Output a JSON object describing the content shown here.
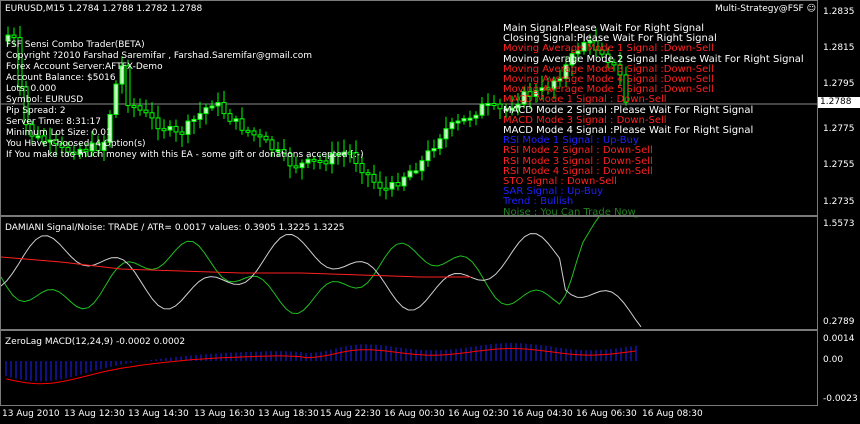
{
  "header": {
    "symbol_title": "EURUSD,M15  1.2784 1.2788 1.2782 1.2788",
    "ea_name": "Multi-Strategy@FSF"
  },
  "ea_info": [
    "FSF Sensi Combo Trader(BETA)",
    "Copyright ?2010 Farshad Saremifar , Farshad.Saremifar@gmail.com",
    "Forex Account Server:AFTFX-Demo",
    "Account Balance:  $5016",
    "Lots:  0.000",
    "Symbol: EURUSD",
    "Pip Spread:  2",
    " Server Time: 8:31:17",
    "Minimum Lot Size: 0.01",
    "You Have Choosed: 4 Option(s)",
    "If You make too much money with this EA - some gift or donations accepted [:-)"
  ],
  "signals": [
    {
      "text": "Main Signal:Please Wait For Right Signal",
      "color": "#ffffff"
    },
    {
      "text": "Closing Signal:Please Wait For Right Signal",
      "color": "#ffffff"
    },
    {
      "text": "Moving Average Mode 1 Signal :Down-Sell",
      "color": "#ff2020"
    },
    {
      "text": "Moving Average Mode 2 Signal :Please Wait For Right Signal",
      "color": "#ffffff"
    },
    {
      "text": "Moving Average Mode 3 Signal :Down-Sell",
      "color": "#ff2020"
    },
    {
      "text": "Moving Average Mode 4 Signal :Down-Sell",
      "color": "#ff2020"
    },
    {
      "text": "Moving Average Mode 5 Signal :Down-Sell",
      "color": "#ff2020"
    },
    {
      "text": "MACD Mode 1 Signal : Down-Sell",
      "color": "#ff2020"
    },
    {
      "text": "MACD Mode 2 Signal :Please Wait For Right Signal",
      "color": "#ffffff"
    },
    {
      "text": "MACD Mode 3 Signal : Down-Sell",
      "color": "#ff2020"
    },
    {
      "text": "MACD Mode 4 Signal :Please Wait For Right Signal",
      "color": "#ffffff"
    },
    {
      "text": "RSI Mode 1 Signal : Up-Buy",
      "color": "#2020ff"
    },
    {
      "text": "RSI Mode 2 Signal : Down-Sell",
      "color": "#ff2020"
    },
    {
      "text": "RSI Mode 3 Signal : Down-Sell",
      "color": "#ff2020"
    },
    {
      "text": "RSI Mode 4 Signal : Down-Sell",
      "color": "#ff2020"
    },
    {
      "text": "STO Signal : Down-Sell",
      "color": "#ff2020"
    },
    {
      "text": "SAR Signal : Up-Buy",
      "color": "#2020ff"
    },
    {
      "text": "Trend : Bullish",
      "color": "#2020ff"
    },
    {
      "text": "Noise : You Can Trade Now",
      "color": "#208020"
    }
  ],
  "price_axis": {
    "labels": [
      "1.2835",
      "1.2815",
      "1.2795",
      "1.2775",
      "1.2755",
      "1.2735"
    ],
    "current": "1.2788"
  },
  "damiani": {
    "title": "DAMIANI Signal/Noise: TRADE  / ATR= 0.0017     values: 0.3905 1.3225 1.3225",
    "axis_top": "1.5573",
    "axis_bottom": "0.2789"
  },
  "macd": {
    "title": "ZeroLag MACD(12,24,9) -0.0002 0.0002",
    "axis_top": "0.0014",
    "axis_mid": "0.00",
    "axis_bottom": "-0.0023"
  },
  "time_axis": [
    "13 Aug 2010",
    "13 Aug 12:30",
    "13 Aug 14:30",
    "13 Aug 16:30",
    "13 Aug 18:30",
    "15 Aug 22:30",
    "16 Aug 00:30",
    "16 Aug 02:30",
    "16 Aug 04:30",
    "16 Aug 06:30",
    "16 Aug 08:30"
  ],
  "colors": {
    "bull_candle": "#ccffcc",
    "candle_wick": "#00ff00",
    "damiani_green": "#20c020",
    "damiani_white": "#d0d0d0",
    "damiani_red": "#ff2020",
    "macd_bars": "#2020ff",
    "macd_signal": "#ff0000"
  }
}
